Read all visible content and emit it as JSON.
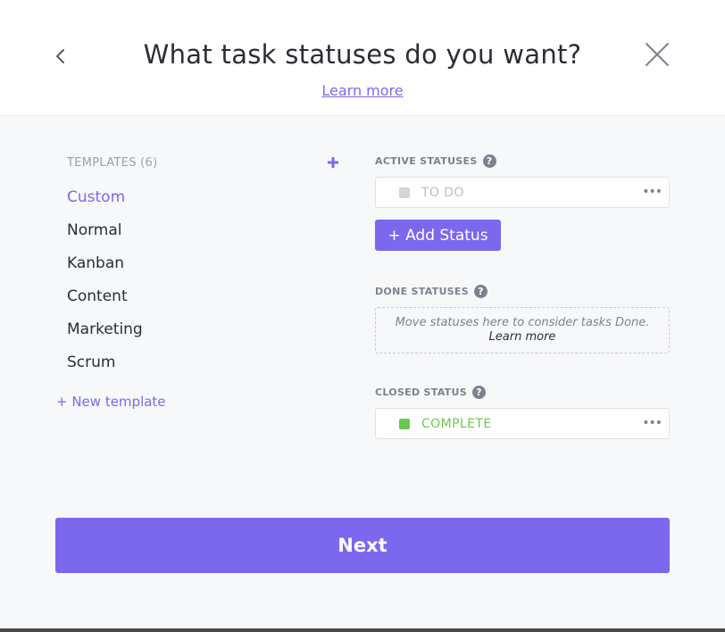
{
  "header": {
    "title": "What task statuses do you want?",
    "learn_more": "Learn more",
    "back_icon": "chevron-left-icon",
    "close_icon": "close-icon"
  },
  "templates": {
    "header": "TEMPLATES (6)",
    "add_icon": "plus-icon",
    "items": [
      {
        "label": "Custom",
        "selected": true
      },
      {
        "label": "Normal",
        "selected": false
      },
      {
        "label": "Kanban",
        "selected": false
      },
      {
        "label": "Content",
        "selected": false
      },
      {
        "label": "Marketing",
        "selected": false
      },
      {
        "label": "Scrum",
        "selected": false
      }
    ],
    "new_template": "+ New template"
  },
  "active": {
    "label": "ACTIVE STATUSES",
    "help": "?",
    "status": {
      "name": "TO DO",
      "color": "#d3d5d8",
      "text_color": "#b9bec7"
    },
    "add_button": "+ Add Status"
  },
  "done": {
    "label": "DONE STATUSES",
    "help": "?",
    "hint": "Move statuses here to consider tasks Done.",
    "hint_link": "Learn more"
  },
  "closed": {
    "label": "CLOSED STATUS",
    "help": "?",
    "status": {
      "name": "COMPLETE",
      "color": "#6bc950",
      "text_color": "#6bc950"
    }
  },
  "menu_dots": "•••",
  "next_button": "Next",
  "colors": {
    "accent": "#7b68ee"
  }
}
